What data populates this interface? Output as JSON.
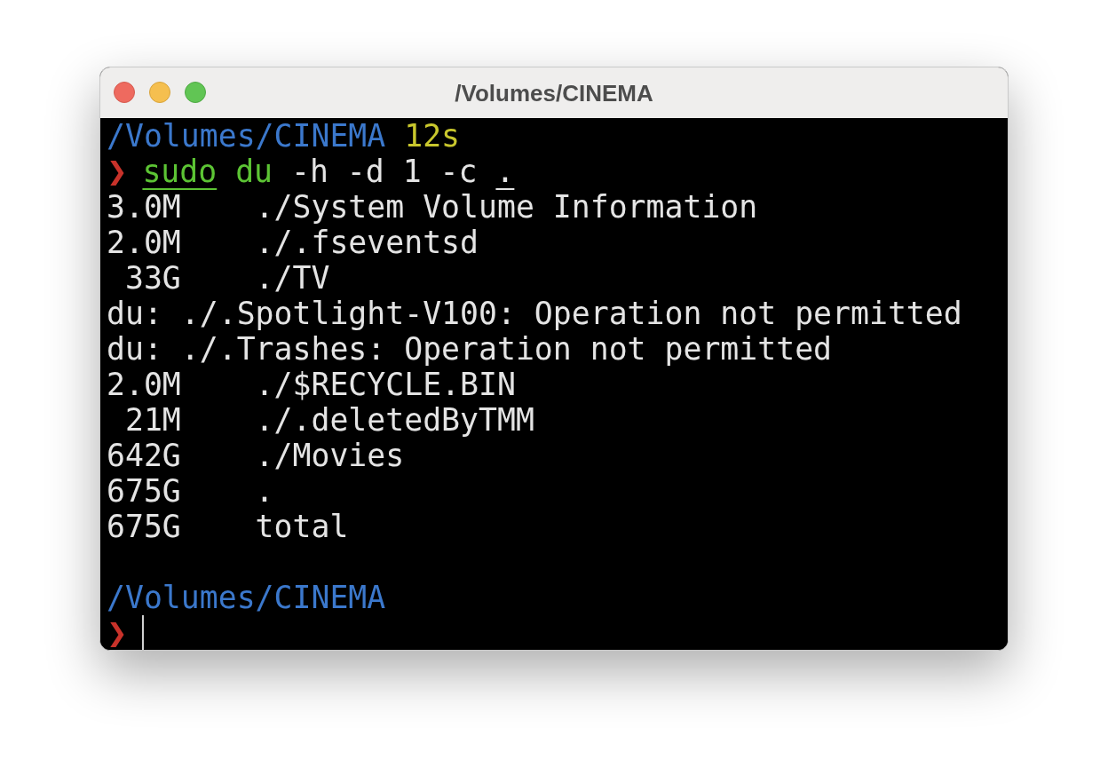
{
  "window": {
    "title": "/Volumes/CINEMA"
  },
  "terminal": {
    "sessions": [
      {
        "path": "/Volumes/CINEMA",
        "duration": "12s",
        "prompt": "❯",
        "command": [
          {
            "text": "sudo",
            "kind": "command",
            "underlined": true
          },
          {
            "text": "du",
            "kind": "command",
            "underlined": false
          },
          {
            "text": "-h",
            "kind": "argument",
            "underlined": false
          },
          {
            "text": "-d",
            "kind": "argument",
            "underlined": false
          },
          {
            "text": "1",
            "kind": "argument",
            "underlined": false
          },
          {
            "text": "-c",
            "kind": "argument",
            "underlined": false
          },
          {
            "text": ".",
            "kind": "argument",
            "underlined": true
          }
        ],
        "output": [
          {
            "kind": "entry",
            "size": "3.0M",
            "name": "./System Volume Information"
          },
          {
            "kind": "entry",
            "size": "2.0M",
            "name": "./.fseventsd"
          },
          {
            "kind": "entry",
            "size": "33G",
            "name": "./TV"
          },
          {
            "kind": "error",
            "text": "du: ./.Spotlight-V100: Operation not permitted"
          },
          {
            "kind": "error",
            "text": "du: ./.Trashes: Operation not permitted"
          },
          {
            "kind": "entry",
            "size": "2.0M",
            "name": "./$RECYCLE.BIN"
          },
          {
            "kind": "entry",
            "size": "21M",
            "name": "./.deletedByTMM"
          },
          {
            "kind": "entry",
            "size": "642G",
            "name": "./Movies"
          },
          {
            "kind": "entry",
            "size": "675G",
            "name": "."
          },
          {
            "kind": "entry",
            "size": "675G",
            "name": "total"
          }
        ]
      },
      {
        "path": "/Volumes/CINEMA",
        "prompt": "❯",
        "cursor": true
      }
    ]
  }
}
